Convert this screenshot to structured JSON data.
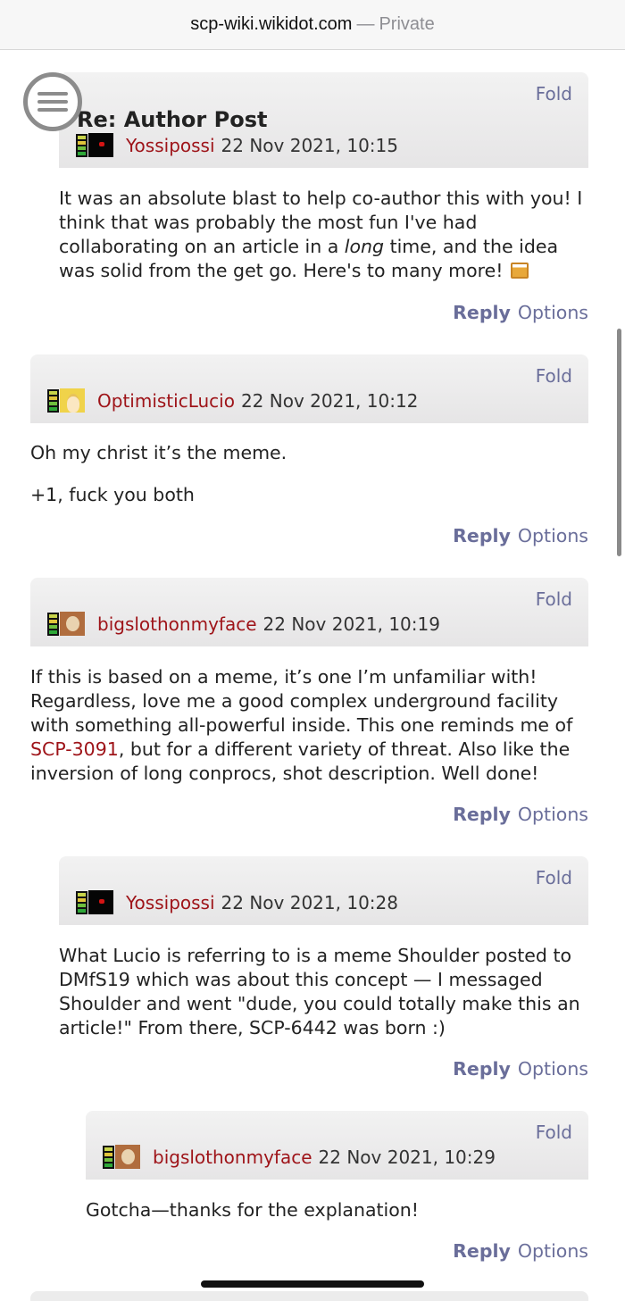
{
  "browser": {
    "domain": "scp-wiki.wikidot.com",
    "separator": "—",
    "mode": "Private"
  },
  "icons": {
    "menu": "hamburger-menu-icon",
    "karma": "karma-meter-icon",
    "drink": "beer-mugs-icon"
  },
  "colors": {
    "username": "#9e1318",
    "action": "#6a6e9a"
  },
  "posts": [
    {
      "title": "Re: Author Post",
      "fold": "Fold",
      "user": "Yossipossi",
      "date": "22 Nov 2021, 10:15",
      "body_1": "It was an absolute blast to help co-author this with you! I think that was probably the most fun I've had collaborating on an article in a ",
      "body_em": "long",
      "body_2": " time, and the idea was solid from the get go. Here's to many more!",
      "reply": "Reply",
      "options": "Options"
    },
    {
      "fold": "Fold",
      "user": "OptimisticLucio",
      "date": "22 Nov 2021, 10:12",
      "para_1": "Oh my christ it’s the meme.",
      "para_2": "+1, fuck you both",
      "reply": "Reply",
      "options": "Options"
    },
    {
      "fold": "Fold",
      "user": "bigslothonmyface",
      "date": "22 Nov 2021, 10:19",
      "body_1": "If this is based on a meme, it’s one I’m unfamiliar with! Regardless, love me a good complex underground facility with something all-powerful inside. This one reminds me of ",
      "link": "SCP-3091",
      "body_2": ", but for a different variety of threat. Also like the inversion of long conprocs, shot description. Well done!",
      "reply": "Reply",
      "options": "Options"
    },
    {
      "fold": "Fold",
      "user": "Yossipossi",
      "date": "22 Nov 2021, 10:28",
      "body": "What Lucio is referring to is a meme Shoulder posted to DMfS19 which was about this concept — I messaged Shoulder and went \"dude, you could totally make this an article!\" From there, SCP-6442 was born :)",
      "reply": "Reply",
      "options": "Options"
    },
    {
      "fold": "Fold",
      "user": "bigslothonmyface",
      "date": "22 Nov 2021, 10:29",
      "body": "Gotcha—thanks for the explanation!",
      "reply": "Reply",
      "options": "Options"
    }
  ]
}
